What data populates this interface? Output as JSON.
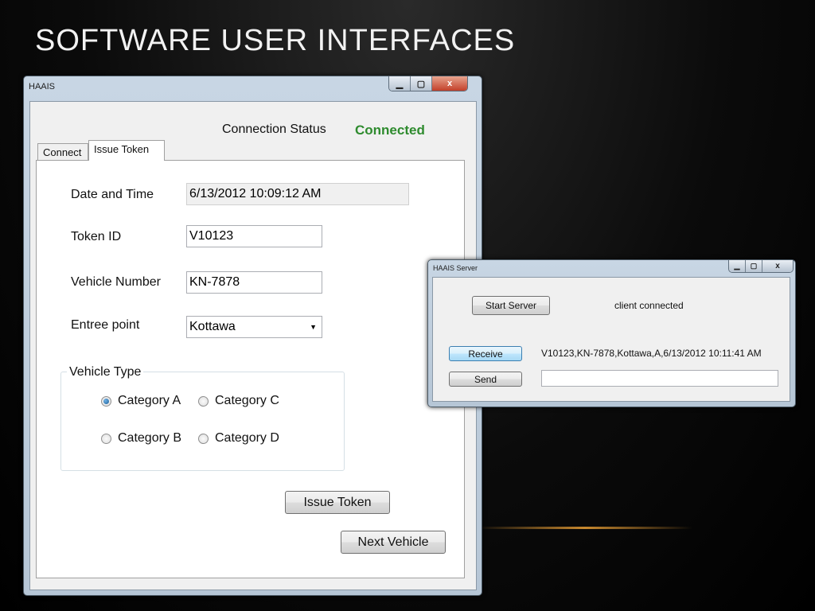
{
  "slide": {
    "title": "SOFTWARE USER INTERFACES"
  },
  "client_window": {
    "title": "HAAIS",
    "controls": {
      "minimize": "▁",
      "maximize": "▢",
      "close": "x"
    },
    "connection_status_label": "Connection Status",
    "connection_status_value": "Connected",
    "tabs": [
      {
        "label": "Connect",
        "active": false
      },
      {
        "label": "Issue Token",
        "active": true
      }
    ],
    "form": {
      "date_time_label": "Date and Time",
      "date_time_value": "6/13/2012 10:09:12 AM",
      "token_id_label": "Token ID",
      "token_id_value": "V10123",
      "vehicle_number_label": "Vehicle Number",
      "vehicle_number_value": "KN-7878",
      "entree_point_label": "Entree point",
      "entree_point_value": "Kottawa"
    },
    "vehicle_type": {
      "legend": "Vehicle Type",
      "options": [
        {
          "label": "Category A",
          "checked": true
        },
        {
          "label": "Category B",
          "checked": false
        },
        {
          "label": "Category C",
          "checked": false
        },
        {
          "label": "Category D",
          "checked": false
        }
      ]
    },
    "buttons": {
      "issue_token": "Issue Token",
      "next_vehicle": "Next Vehicle"
    },
    "colors": {
      "status_connected": "#2e8b2e"
    }
  },
  "server_window": {
    "title": "HAAIS Server",
    "controls": {
      "minimize": "▁",
      "maximize": "▢",
      "close": "x"
    },
    "start_server_label": "Start Server",
    "status_text": "client connected",
    "receive_label": "Receive",
    "received_data": "V10123,KN-7878,Kottawa,A,6/13/2012 10:11:41 AM",
    "send_label": "Send",
    "send_value": ""
  }
}
